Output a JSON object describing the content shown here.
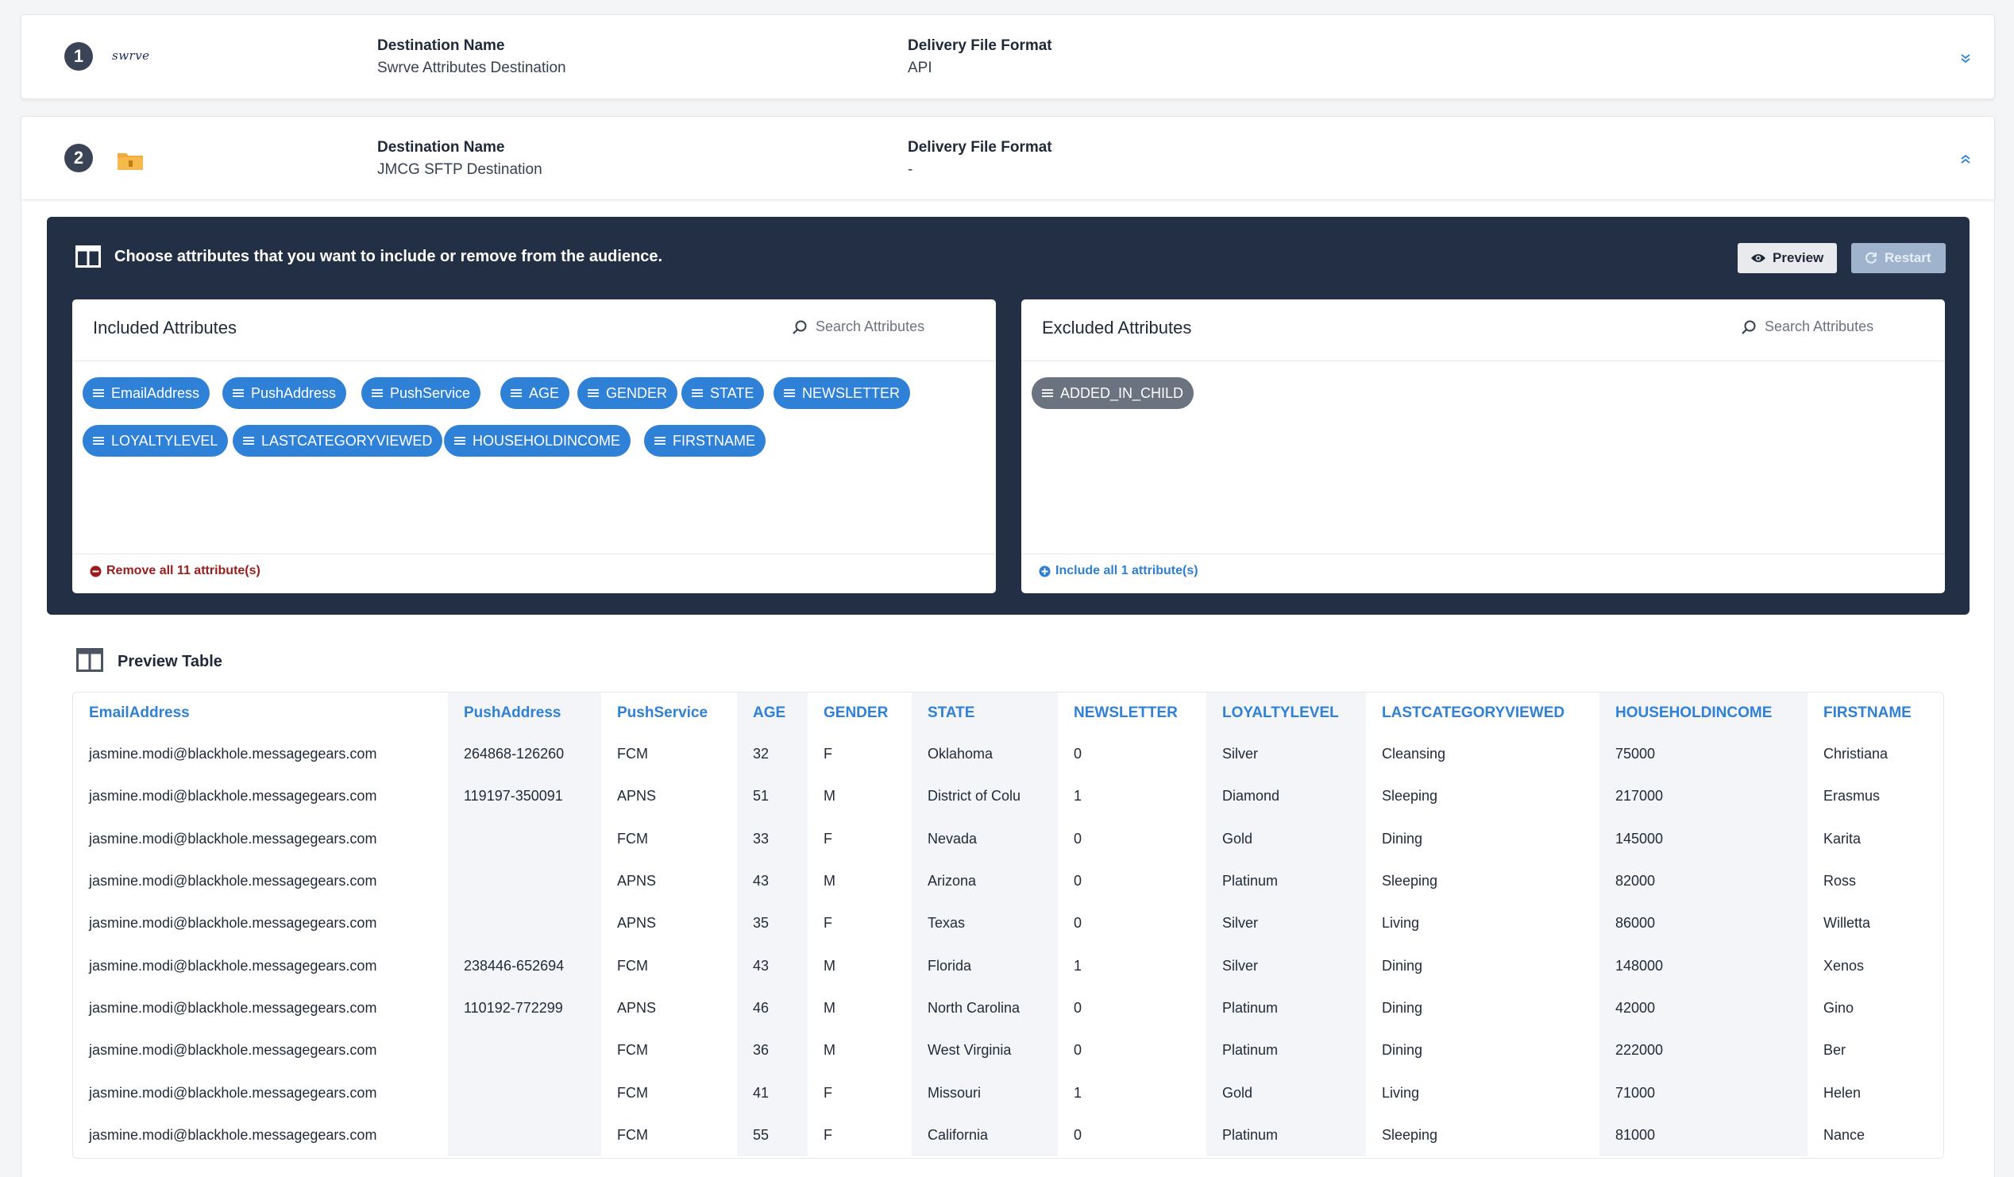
{
  "destinations": [
    {
      "step": "1",
      "logo": "swrve-logo",
      "logo_text": "swrve",
      "name_label": "Destination Name",
      "name_value": "Swrve Attributes Destination",
      "format_label": "Delivery File Format",
      "format_value": "API"
    },
    {
      "step": "2",
      "logo": "sftp-folder-icon",
      "name_label": "Destination Name",
      "name_value": "JMCG SFTP Destination",
      "format_label": "Delivery File Format",
      "format_value": "-"
    }
  ],
  "attributes_panel": {
    "title": "Choose attributes that you want to include or remove from the audience.",
    "preview_label": "Preview",
    "restart_label": "Restart",
    "included": {
      "title": "Included Attributes",
      "search_placeholder": "Search Attributes",
      "chips": [
        "EmailAddress",
        "PushAddress",
        "PushService",
        "AGE",
        "GENDER",
        "STATE",
        "NEWSLETTER",
        "LOYALTYLEVEL",
        "LASTCATEGORYVIEWED",
        "HOUSEHOLDINCOME",
        "FIRSTNAME"
      ],
      "footer": "Remove all 11 attribute(s)"
    },
    "excluded": {
      "title": "Excluded Attributes",
      "search_placeholder": "Search Attributes",
      "chips": [
        "ADDED_IN_CHILD"
      ],
      "footer": "Include all 1 attribute(s)"
    }
  },
  "preview": {
    "title": "Preview Table",
    "columns": [
      "EmailAddress",
      "PushAddress",
      "PushService",
      "AGE",
      "GENDER",
      "STATE",
      "NEWSLETTER",
      "LOYALTYLEVEL",
      "LASTCATEGORYVIEWED",
      "HOUSEHOLDINCOME",
      "FIRSTNAME"
    ],
    "rows": [
      [
        "jasmine.modi@blackhole.messagegears.com",
        "264868-126260",
        "FCM",
        "32",
        "F",
        "Oklahoma",
        "0",
        "Silver",
        "Cleansing",
        "75000",
        "Christiana"
      ],
      [
        "jasmine.modi@blackhole.messagegears.com",
        "119197-350091",
        "APNS",
        "51",
        "M",
        "District of Colu",
        "1",
        "Diamond",
        "Sleeping",
        "217000",
        "Erasmus"
      ],
      [
        "jasmine.modi@blackhole.messagegears.com",
        "",
        "FCM",
        "33",
        "F",
        "Nevada",
        "0",
        "Gold",
        "Dining",
        "145000",
        "Karita"
      ],
      [
        "jasmine.modi@blackhole.messagegears.com",
        "",
        "APNS",
        "43",
        "M",
        "Arizona",
        "0",
        "Platinum",
        "Sleeping",
        "82000",
        "Ross"
      ],
      [
        "jasmine.modi@blackhole.messagegears.com",
        "",
        "APNS",
        "35",
        "F",
        "Texas",
        "0",
        "Silver",
        "Living",
        "86000",
        "Willetta"
      ],
      [
        "jasmine.modi@blackhole.messagegears.com",
        "238446-652694",
        "FCM",
        "43",
        "M",
        "Florida",
        "1",
        "Silver",
        "Dining",
        "148000",
        "Xenos"
      ],
      [
        "jasmine.modi@blackhole.messagegears.com",
        "110192-772299",
        "APNS",
        "46",
        "M",
        "North Carolina",
        "0",
        "Platinum",
        "Dining",
        "42000",
        "Gino"
      ],
      [
        "jasmine.modi@blackhole.messagegears.com",
        "",
        "FCM",
        "36",
        "M",
        "West Virginia",
        "0",
        "Platinum",
        "Dining",
        "222000",
        "Ber"
      ],
      [
        "jasmine.modi@blackhole.messagegears.com",
        "",
        "FCM",
        "41",
        "F",
        "Missouri",
        "1",
        "Gold",
        "Living",
        "71000",
        "Helen"
      ],
      [
        "jasmine.modi@blackhole.messagegears.com",
        "",
        "FCM",
        "55",
        "F",
        "California",
        "0",
        "Platinum",
        "Sleeping",
        "81000",
        "Nance"
      ]
    ]
  },
  "colors": {
    "panel_bg": "#232f45",
    "chip_blue": "#2f80d7",
    "chip_grey": "#6b7280",
    "remove_red": "#9b1c1c",
    "link_blue": "#2f7fd1"
  }
}
